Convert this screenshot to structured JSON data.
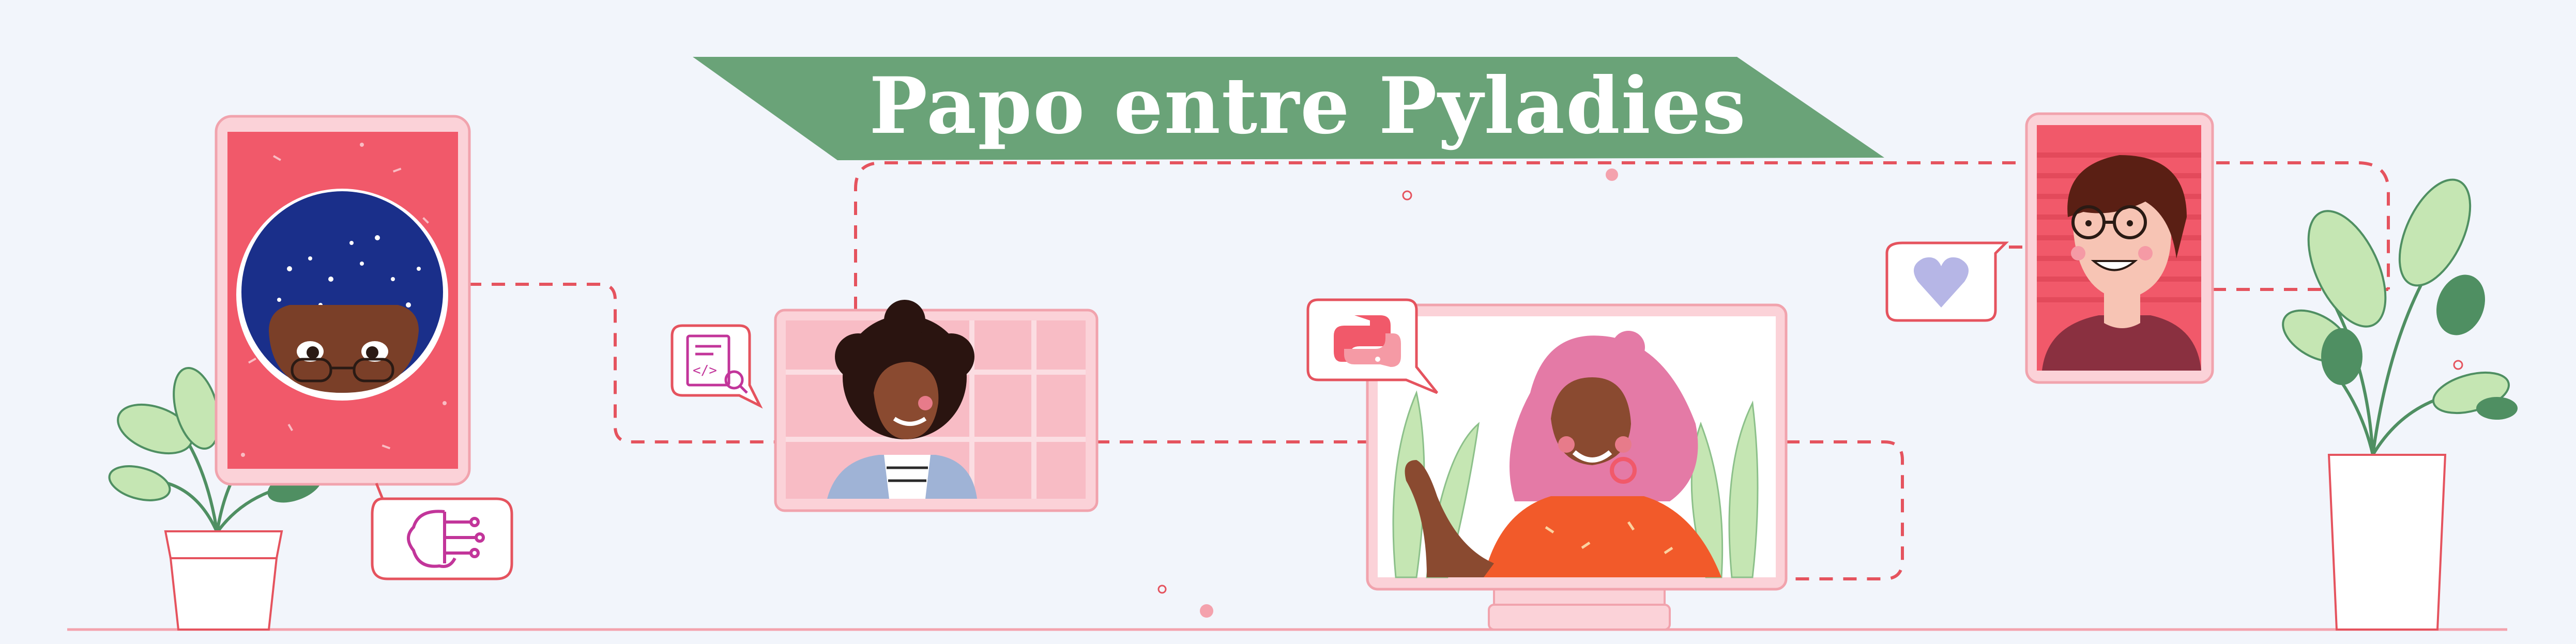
{
  "banner": {
    "title": "Papo entre Pyladies"
  },
  "colors": {
    "background": "#f2f5fb",
    "banner_green": "#6aa378",
    "accent_red": "#f1596a",
    "frame_pink": "#fbd2d8",
    "line_red": "#e5535e",
    "plant_light": "#c5e6b3",
    "plant_dark": "#4f8f62",
    "heart": "#b6b6e6"
  },
  "icons": [
    "brain-circuit-icon",
    "code-document-icon",
    "python-logo-icon",
    "heart-icon"
  ]
}
